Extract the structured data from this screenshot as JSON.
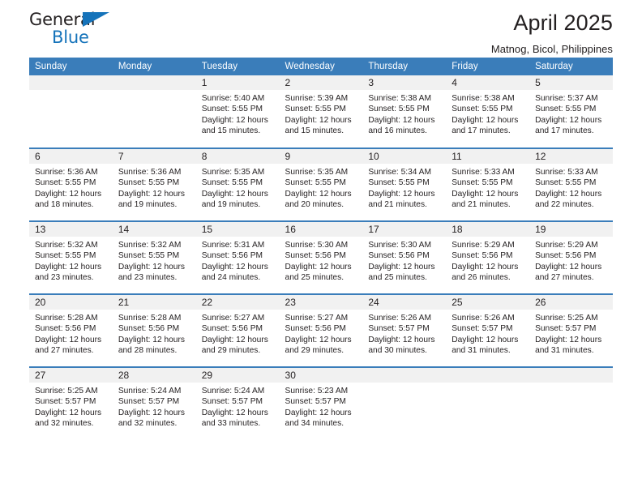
{
  "brand": {
    "name_dark": "General",
    "name_blue": "Blue",
    "accent_color": "#1573ba",
    "header_color": "#3a7dba",
    "band_color": "#f1f1f1"
  },
  "header": {
    "title": "April 2025",
    "subtitle": "Matnog, Bicol, Philippines"
  },
  "weekday_headers": [
    "Sunday",
    "Monday",
    "Tuesday",
    "Wednesday",
    "Thursday",
    "Friday",
    "Saturday"
  ],
  "weeks": [
    [
      {
        "day": "",
        "blank": true,
        "sunrise": "",
        "sunset": "",
        "daylight1": "",
        "daylight2": ""
      },
      {
        "day": "",
        "blank": true,
        "sunrise": "",
        "sunset": "",
        "daylight1": "",
        "daylight2": ""
      },
      {
        "day": "1",
        "sunrise": "Sunrise: 5:40 AM",
        "sunset": "Sunset: 5:55 PM",
        "daylight1": "Daylight: 12 hours",
        "daylight2": "and 15 minutes."
      },
      {
        "day": "2",
        "sunrise": "Sunrise: 5:39 AM",
        "sunset": "Sunset: 5:55 PM",
        "daylight1": "Daylight: 12 hours",
        "daylight2": "and 15 minutes."
      },
      {
        "day": "3",
        "sunrise": "Sunrise: 5:38 AM",
        "sunset": "Sunset: 5:55 PM",
        "daylight1": "Daylight: 12 hours",
        "daylight2": "and 16 minutes."
      },
      {
        "day": "4",
        "sunrise": "Sunrise: 5:38 AM",
        "sunset": "Sunset: 5:55 PM",
        "daylight1": "Daylight: 12 hours",
        "daylight2": "and 17 minutes."
      },
      {
        "day": "5",
        "sunrise": "Sunrise: 5:37 AM",
        "sunset": "Sunset: 5:55 PM",
        "daylight1": "Daylight: 12 hours",
        "daylight2": "and 17 minutes."
      }
    ],
    [
      {
        "day": "6",
        "sunrise": "Sunrise: 5:36 AM",
        "sunset": "Sunset: 5:55 PM",
        "daylight1": "Daylight: 12 hours",
        "daylight2": "and 18 minutes."
      },
      {
        "day": "7",
        "sunrise": "Sunrise: 5:36 AM",
        "sunset": "Sunset: 5:55 PM",
        "daylight1": "Daylight: 12 hours",
        "daylight2": "and 19 minutes."
      },
      {
        "day": "8",
        "sunrise": "Sunrise: 5:35 AM",
        "sunset": "Sunset: 5:55 PM",
        "daylight1": "Daylight: 12 hours",
        "daylight2": "and 19 minutes."
      },
      {
        "day": "9",
        "sunrise": "Sunrise: 5:35 AM",
        "sunset": "Sunset: 5:55 PM",
        "daylight1": "Daylight: 12 hours",
        "daylight2": "and 20 minutes."
      },
      {
        "day": "10",
        "sunrise": "Sunrise: 5:34 AM",
        "sunset": "Sunset: 5:55 PM",
        "daylight1": "Daylight: 12 hours",
        "daylight2": "and 21 minutes."
      },
      {
        "day": "11",
        "sunrise": "Sunrise: 5:33 AM",
        "sunset": "Sunset: 5:55 PM",
        "daylight1": "Daylight: 12 hours",
        "daylight2": "and 21 minutes."
      },
      {
        "day": "12",
        "sunrise": "Sunrise: 5:33 AM",
        "sunset": "Sunset: 5:55 PM",
        "daylight1": "Daylight: 12 hours",
        "daylight2": "and 22 minutes."
      }
    ],
    [
      {
        "day": "13",
        "sunrise": "Sunrise: 5:32 AM",
        "sunset": "Sunset: 5:55 PM",
        "daylight1": "Daylight: 12 hours",
        "daylight2": "and 23 minutes."
      },
      {
        "day": "14",
        "sunrise": "Sunrise: 5:32 AM",
        "sunset": "Sunset: 5:55 PM",
        "daylight1": "Daylight: 12 hours",
        "daylight2": "and 23 minutes."
      },
      {
        "day": "15",
        "sunrise": "Sunrise: 5:31 AM",
        "sunset": "Sunset: 5:56 PM",
        "daylight1": "Daylight: 12 hours",
        "daylight2": "and 24 minutes."
      },
      {
        "day": "16",
        "sunrise": "Sunrise: 5:30 AM",
        "sunset": "Sunset: 5:56 PM",
        "daylight1": "Daylight: 12 hours",
        "daylight2": "and 25 minutes."
      },
      {
        "day": "17",
        "sunrise": "Sunrise: 5:30 AM",
        "sunset": "Sunset: 5:56 PM",
        "daylight1": "Daylight: 12 hours",
        "daylight2": "and 25 minutes."
      },
      {
        "day": "18",
        "sunrise": "Sunrise: 5:29 AM",
        "sunset": "Sunset: 5:56 PM",
        "daylight1": "Daylight: 12 hours",
        "daylight2": "and 26 minutes."
      },
      {
        "day": "19",
        "sunrise": "Sunrise: 5:29 AM",
        "sunset": "Sunset: 5:56 PM",
        "daylight1": "Daylight: 12 hours",
        "daylight2": "and 27 minutes."
      }
    ],
    [
      {
        "day": "20",
        "sunrise": "Sunrise: 5:28 AM",
        "sunset": "Sunset: 5:56 PM",
        "daylight1": "Daylight: 12 hours",
        "daylight2": "and 27 minutes."
      },
      {
        "day": "21",
        "sunrise": "Sunrise: 5:28 AM",
        "sunset": "Sunset: 5:56 PM",
        "daylight1": "Daylight: 12 hours",
        "daylight2": "and 28 minutes."
      },
      {
        "day": "22",
        "sunrise": "Sunrise: 5:27 AM",
        "sunset": "Sunset: 5:56 PM",
        "daylight1": "Daylight: 12 hours",
        "daylight2": "and 29 minutes."
      },
      {
        "day": "23",
        "sunrise": "Sunrise: 5:27 AM",
        "sunset": "Sunset: 5:56 PM",
        "daylight1": "Daylight: 12 hours",
        "daylight2": "and 29 minutes."
      },
      {
        "day": "24",
        "sunrise": "Sunrise: 5:26 AM",
        "sunset": "Sunset: 5:57 PM",
        "daylight1": "Daylight: 12 hours",
        "daylight2": "and 30 minutes."
      },
      {
        "day": "25",
        "sunrise": "Sunrise: 5:26 AM",
        "sunset": "Sunset: 5:57 PM",
        "daylight1": "Daylight: 12 hours",
        "daylight2": "and 31 minutes."
      },
      {
        "day": "26",
        "sunrise": "Sunrise: 5:25 AM",
        "sunset": "Sunset: 5:57 PM",
        "daylight1": "Daylight: 12 hours",
        "daylight2": "and 31 minutes."
      }
    ],
    [
      {
        "day": "27",
        "sunrise": "Sunrise: 5:25 AM",
        "sunset": "Sunset: 5:57 PM",
        "daylight1": "Daylight: 12 hours",
        "daylight2": "and 32 minutes."
      },
      {
        "day": "28",
        "sunrise": "Sunrise: 5:24 AM",
        "sunset": "Sunset: 5:57 PM",
        "daylight1": "Daylight: 12 hours",
        "daylight2": "and 32 minutes."
      },
      {
        "day": "29",
        "sunrise": "Sunrise: 5:24 AM",
        "sunset": "Sunset: 5:57 PM",
        "daylight1": "Daylight: 12 hours",
        "daylight2": "and 33 minutes."
      },
      {
        "day": "30",
        "sunrise": "Sunrise: 5:23 AM",
        "sunset": "Sunset: 5:57 PM",
        "daylight1": "Daylight: 12 hours",
        "daylight2": "and 34 minutes."
      },
      {
        "day": "",
        "blank": true,
        "sunrise": "",
        "sunset": "",
        "daylight1": "",
        "daylight2": ""
      },
      {
        "day": "",
        "blank": true,
        "sunrise": "",
        "sunset": "",
        "daylight1": "",
        "daylight2": ""
      },
      {
        "day": "",
        "blank": true,
        "sunrise": "",
        "sunset": "",
        "daylight1": "",
        "daylight2": ""
      }
    ]
  ]
}
